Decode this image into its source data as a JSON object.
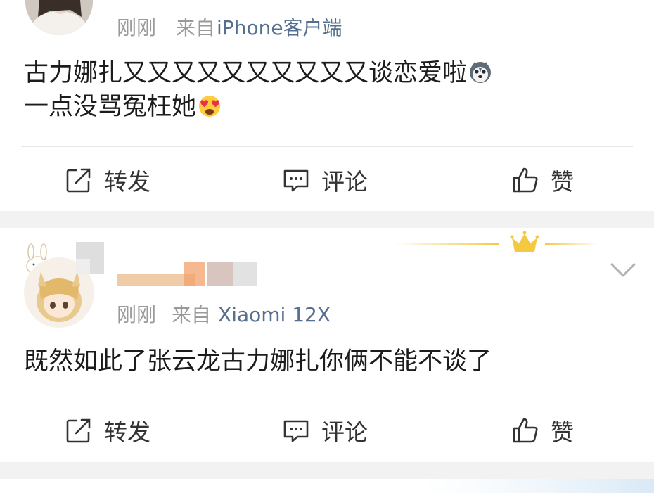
{
  "posts": [
    {
      "time": "刚刚",
      "source_prefix": "来自",
      "source": "iPhone客户端",
      "line1": "古力娜扎又又又又又又又又又又谈恋爱啦",
      "line2": "一点没骂冤枉她",
      "actions": {
        "repost": "转发",
        "comment": "评论",
        "like": "赞"
      },
      "emoji1": "husky-emoji",
      "emoji2": "heart-eyes-emoji"
    },
    {
      "time": "刚刚",
      "source_prefix": "来自",
      "source": "Xiaomi 12X",
      "text": "既然如此了张云龙古力娜扎你俩不能不谈了",
      "actions": {
        "repost": "转发",
        "comment": "评论",
        "like": "赞"
      },
      "crown": "crown-icon",
      "menu": "chevron-down-icon"
    }
  ],
  "colors": {
    "source_link": "#55708f",
    "meta_gray": "#9a9a9a",
    "crown_gold": "#f5c842"
  }
}
